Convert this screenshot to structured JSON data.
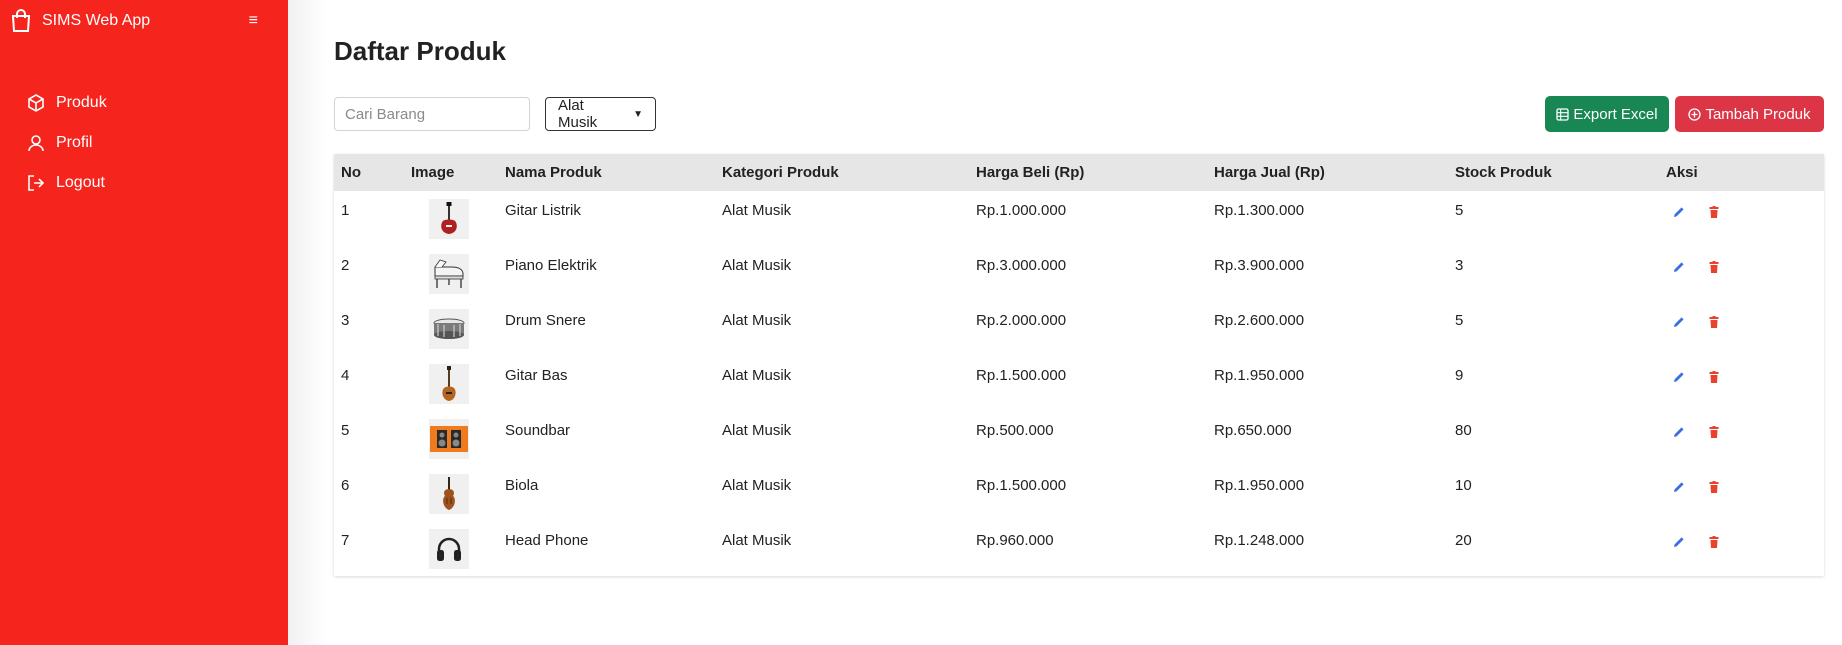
{
  "app": {
    "title": "SIMS Web App",
    "menu_icon": "hamburger-icon"
  },
  "sidebar": {
    "items": [
      {
        "label": "Produk",
        "icon": "box-icon"
      },
      {
        "label": "Profil",
        "icon": "user-icon"
      },
      {
        "label": "Logout",
        "icon": "logout-icon"
      }
    ]
  },
  "page": {
    "title": "Daftar Produk"
  },
  "toolbar": {
    "search_placeholder": "Cari Barang",
    "category_selected": "Alat Musik",
    "export_label": "Export Excel",
    "add_label": "Tambah Produk"
  },
  "table": {
    "headers": [
      "No",
      "Image",
      "Nama Produk",
      "Kategori Produk",
      "Harga Beli (Rp)",
      "Harga Jual (Rp)",
      "Stock Produk",
      "Aksi"
    ],
    "rows": [
      {
        "no": "1",
        "image": "electric-guitar",
        "name": "Gitar Listrik",
        "category": "Alat Musik",
        "buy": "Rp.1.000.000",
        "sell": "Rp.1.300.000",
        "stock": "5"
      },
      {
        "no": "2",
        "image": "grand-piano",
        "name": "Piano Elektrik",
        "category": "Alat Musik",
        "buy": "Rp.3.000.000",
        "sell": "Rp.3.900.000",
        "stock": "3"
      },
      {
        "no": "3",
        "image": "snare-drum",
        "name": "Drum Snere",
        "category": "Alat Musik",
        "buy": "Rp.2.000.000",
        "sell": "Rp.2.600.000",
        "stock": "5"
      },
      {
        "no": "4",
        "image": "bass-guitar",
        "name": "Gitar Bas",
        "category": "Alat Musik",
        "buy": "Rp.1.500.000",
        "sell": "Rp.1.950.000",
        "stock": "9"
      },
      {
        "no": "5",
        "image": "soundbar",
        "name": "Soundbar",
        "category": "Alat Musik",
        "buy": "Rp.500.000",
        "sell": "Rp.650.000",
        "stock": "80"
      },
      {
        "no": "6",
        "image": "violin",
        "name": "Biola",
        "category": "Alat Musik",
        "buy": "Rp.1.500.000",
        "sell": "Rp.1.950.000",
        "stock": "10"
      },
      {
        "no": "7",
        "image": "headphone",
        "name": "Head Phone",
        "category": "Alat Musik",
        "buy": "Rp.960.000",
        "sell": "Rp.1.248.000",
        "stock": "20"
      }
    ]
  },
  "colors": {
    "sidebar": "#f5241c",
    "excel": "#198754",
    "add": "#dc3545",
    "edit": "#3b6fe0",
    "delete": "#e8412c"
  }
}
